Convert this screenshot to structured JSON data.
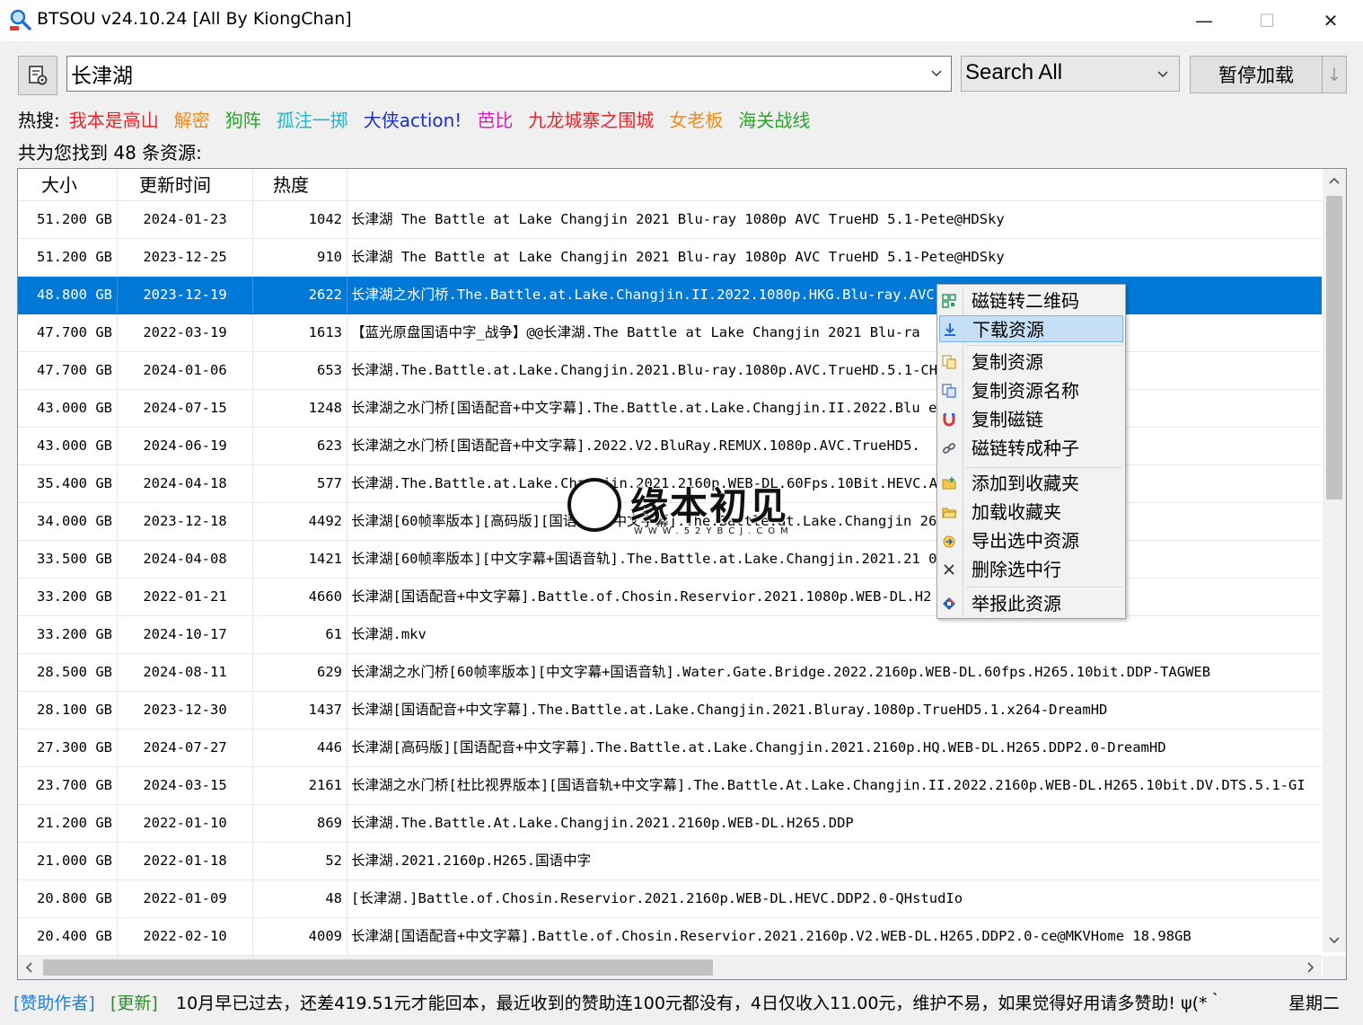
{
  "window": {
    "title": "BTSOU v24.10.24 [All By KiongChan]",
    "minimize_glyph": "—",
    "maximize_glyph": "☐",
    "close_glyph": "✕"
  },
  "toolbar": {
    "search_value": "长津湖",
    "mode": "Search All",
    "pause_label": "暂停加载",
    "split_glyph": "↓"
  },
  "hot": {
    "label": "热搜:",
    "items": [
      {
        "text": "我本是高山",
        "color": "#e8242a"
      },
      {
        "text": "解密",
        "color": "#f08c1c"
      },
      {
        "text": "狗阵",
        "color": "#2aa52a"
      },
      {
        "text": "孤注一掷",
        "color": "#25b3c6"
      },
      {
        "text": "大侠action!",
        "color": "#1e2fc4"
      },
      {
        "text": "芭比",
        "color": "#d321b8"
      },
      {
        "text": "九龙城寨之围城",
        "color": "#e8242a"
      },
      {
        "text": "女老板",
        "color": "#f08c1c"
      },
      {
        "text": "海关战线",
        "color": "#2aa52a"
      }
    ]
  },
  "result_count": "共为您找到 48 条资源:",
  "columns": {
    "size": "大小",
    "time": "更新时间",
    "heat": "热度"
  },
  "rows": [
    {
      "size": "51.200 GB",
      "time": "2024-01-23",
      "heat": "1042",
      "name": "长津湖 The Battle at Lake Changjin 2021 Blu-ray 1080p AVC TrueHD 5.1-Pete@HDSky"
    },
    {
      "size": "51.200 GB",
      "time": "2023-12-25",
      "heat": "910",
      "name": "长津湖 The Battle at Lake Changjin 2021 Blu-ray 1080p AVC TrueHD 5.1-Pete@HDSky"
    },
    {
      "size": "48.800 GB",
      "time": "2023-12-19",
      "heat": "2622",
      "name": "长津湖之水门桥.The.Battle.at.Lake.Changjin.II.2022.1080p.HKG.Blu-ray.AVC.",
      "selected": true
    },
    {
      "size": "47.700 GB",
      "time": "2022-03-19",
      "heat": "1613",
      "name": "【蓝光原盘国语中字_战争】@@长津湖.The Battle at Lake Changjin 2021 Blu-ra"
    },
    {
      "size": "47.700 GB",
      "time": "2024-01-06",
      "heat": "653",
      "name": "长津湖.The.Battle.at.Lake.Changjin.2021.Blu-ray.1080p.AVC.TrueHD.5.1-CHDB"
    },
    {
      "size": "43.000 GB",
      "time": "2024-07-15",
      "heat": "1248",
      "name": "长津湖之水门桥[国语配音+中文字幕].The.Battle.at.Lake.Changjin.II.2022.Blu                              eHD5.1-DreamHD"
    },
    {
      "size": "43.000 GB",
      "time": "2024-06-19",
      "heat": "623",
      "name": "长津湖之水门桥[国语配音+中文字幕].2022.V2.BluRay.REMUX.1080p.AVC.TrueHD5."
    },
    {
      "size": "35.400 GB",
      "time": "2024-04-18",
      "heat": "577",
      "name": "长津湖.The.Battle.at.Lake.Changjin.2021.2160p.WEB-DL.60Fps.10Bit.HEVC.AAC"
    },
    {
      "size": "34.000 GB",
      "time": "2023-12-18",
      "heat": "4492",
      "name": "长津湖[60帧率版本][高码版][国语配音+中文字幕].The.Battle.at.Lake.Changjin                              265.60fps.DDP2.0-DreamHD"
    },
    {
      "size": "33.500 GB",
      "time": "2024-04-08",
      "heat": "1421",
      "name": "长津湖[60帧率版本][中文字幕+国语音轨].The.Battle.at.Lake.Changjin.2021.21                              0bit.DDP-TAGWEB"
    },
    {
      "size": "33.200 GB",
      "time": "2022-01-21",
      "heat": "4660",
      "name": "长津湖[国语配音+中文字幕].Battle.of.Chosin.Reservior.2021.1080p.WEB-DL.H2"
    },
    {
      "size": "33.200 GB",
      "time": "2024-10-17",
      "heat": "61",
      "name": "长津湖.mkv"
    },
    {
      "size": "28.500 GB",
      "time": "2024-08-11",
      "heat": "629",
      "name": "长津湖之水门桥[60帧率版本][中文字幕+国语音轨].Water.Gate.Bridge.2022.2160p.WEB-DL.60fps.H265.10bit.DDP-TAGWEB"
    },
    {
      "size": "28.100 GB",
      "time": "2023-12-30",
      "heat": "1437",
      "name": "长津湖[国语配音+中文字幕].The.Battle.at.Lake.Changjin.2021.Bluray.1080p.TrueHD5.1.x264-DreamHD"
    },
    {
      "size": "27.300 GB",
      "time": "2024-07-27",
      "heat": "446",
      "name": "长津湖[高码版][国语配音+中文字幕].The.Battle.at.Lake.Changjin.2021.2160p.HQ.WEB-DL.H265.DDP2.0-DreamHD"
    },
    {
      "size": "23.700 GB",
      "time": "2024-03-15",
      "heat": "2161",
      "name": "长津湖之水门桥[杜比视界版本][国语音轨+中文字幕].The.Battle.At.Lake.Changjin.II.2022.2160p.WEB-DL.H265.10bit.DV.DTS.5.1-GI"
    },
    {
      "size": "21.200 GB",
      "time": "2022-01-10",
      "heat": "869",
      "name": "长津湖.The.Battle.At.Lake.Changjin.2021.2160p.WEB-DL.H265.DDP"
    },
    {
      "size": "21.000 GB",
      "time": "2022-01-18",
      "heat": "52",
      "name": "长津湖.2021.2160p.H265.国语中字"
    },
    {
      "size": "20.800 GB",
      "time": "2022-01-09",
      "heat": "48",
      "name": "[长津湖.]Battle.of.Chosin.Reservior.2021.2160p.WEB-DL.HEVC.DDP2.0-QHstudIo"
    },
    {
      "size": "20.400 GB",
      "time": "2022-02-10",
      "heat": "4009",
      "name": "长津湖[国语配音+中文字幕].Battle.of.Chosin.Reservior.2021.2160p.V2.WEB-DL.H265.DDP2.0-ce@MKVHome 18.98GB"
    }
  ],
  "context_menu": {
    "items": [
      {
        "label": "磁链转二维码",
        "icon": "qrcode-icon"
      },
      {
        "label": "下载资源",
        "icon": "download-icon",
        "highlighted": true
      },
      {
        "label": "复制资源",
        "icon": "copy-icon"
      },
      {
        "label": "复制资源名称",
        "icon": "copy-name-icon"
      },
      {
        "label": "复制磁链",
        "icon": "magnet-icon"
      },
      {
        "label": "磁链转成种子",
        "icon": "link-icon"
      },
      {
        "label": "添加到收藏夹",
        "icon": "folder-add-icon"
      },
      {
        "label": "加载收藏夹",
        "icon": "folder-open-icon"
      },
      {
        "label": "导出选中资源",
        "icon": "export-icon"
      },
      {
        "label": "删除选中行",
        "icon": "delete-icon"
      },
      {
        "label": "举报此资源",
        "icon": "report-icon"
      }
    ]
  },
  "watermark": {
    "text": "缘本初见",
    "url": "WWW.52YBCJ.COM"
  },
  "status": {
    "sponsor": "[赞助作者]",
    "update": "[更新]",
    "message": "10月早已过去，还差419.51元才能回本，最近收到的赞助连100元都没有，4日仅收入11.00元，维护不易，如果觉得好用请多赞助! ψ(*｀",
    "weekday": "星期二"
  },
  "colors": {
    "selection": "#0078d7",
    "menu_highlight": "#c5dff6",
    "sponsor": "#1e7fd8",
    "update": "#2e8b2e"
  }
}
